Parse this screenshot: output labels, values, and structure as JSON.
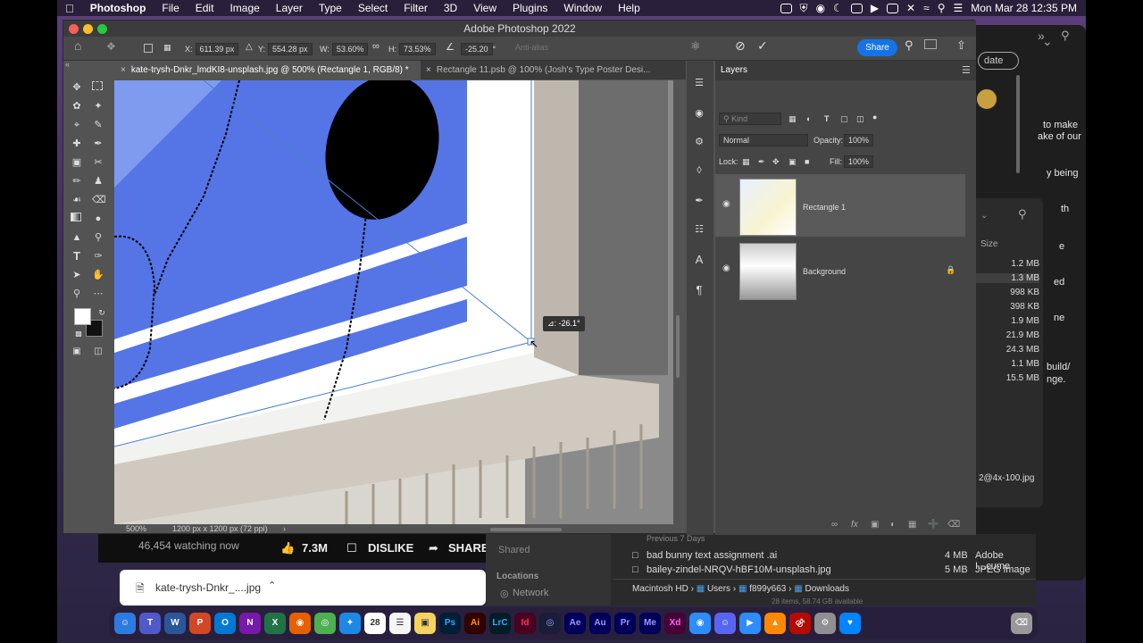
{
  "menubar": {
    "apple": "",
    "app": "Photoshop",
    "items": [
      "File",
      "Edit",
      "Image",
      "Layer",
      "Type",
      "Select",
      "Filter",
      "3D",
      "View",
      "Plugins",
      "Window",
      "Help"
    ],
    "clock": "Mon Mar 28  12:35 PM"
  },
  "window": {
    "title": "Adobe Photoshop 2022"
  },
  "options": {
    "x_label": "X:",
    "x_value": "611.39 px",
    "y_label": "Y:",
    "y_value": "554.28 px",
    "w_label": "W:",
    "w_value": "53.60%",
    "h_label": "H:",
    "h_value": "73.53%",
    "angle_value": "-25.20",
    "angle_unit": "°",
    "antialias": "Anti-alias",
    "share": "Share"
  },
  "tabs": [
    {
      "label": "kate-trysh-Dnkr_lmdKI8-unsplash.jpg @ 500% (Rectangle 1, RGB/8) *"
    },
    {
      "label": "Rectangle 11.psb @ 100% (Josh's Type Poster Desi..."
    }
  ],
  "canvas": {
    "angle_readout": "⊿: -26.1°"
  },
  "status": {
    "zoom": "500%",
    "size": "1200 px x 1200 px (72 ppi)"
  },
  "layers_panel": {
    "title": "Layers",
    "kind": "Kind",
    "blend": "Normal",
    "opacity_label": "Opacity:",
    "opacity": "100%",
    "lock_label": "Lock:",
    "fill_label": "Fill:",
    "fill": "100%",
    "layers": [
      {
        "name": "Rectangle 1"
      },
      {
        "name": "Background"
      }
    ]
  },
  "browser_bg": {
    "update": "date",
    "lines": [
      "to make",
      "ake of our",
      "y being",
      "th",
      "e",
      "ed",
      "ne",
      "build/",
      "nge."
    ]
  },
  "finder_bg": {
    "size_header": "Size",
    "sizes": [
      "1.2 MB",
      "1.3 MB",
      "998 KB",
      "398 KB",
      "1.9 MB",
      "21.9 MB",
      "24.3 MB",
      "1.1 MB",
      "15.5 MB"
    ],
    "file_tail": "2@4x-100.jpg"
  },
  "youtube": {
    "views": "46,454 watching now",
    "likes": "7.3M",
    "dislike": "DISLIKE",
    "share": "SHARE"
  },
  "download": {
    "filename": "kate-trysh-Dnkr_....jpg"
  },
  "finder_bottom": {
    "shared": "Shared",
    "locations": "Locations",
    "network": "Network",
    "prev": "Previous 7 Days",
    "files": [
      {
        "name": "bad bunny text assignment .ai",
        "size": "4 MB",
        "kind": "Adobe I...cume"
      },
      {
        "name": "bailey-zindel-NRQV-hBF10M-unsplash.jpg",
        "size": "5 MB",
        "kind": "JPEG image"
      }
    ],
    "path": [
      "Macintosh HD",
      "Users",
      "f899y663",
      "Downloads"
    ],
    "items_count": "28 items, 58.74 GB available"
  },
  "dock": {
    "apps": [
      "Finder",
      "Teams",
      "Word",
      "PowerPoint",
      "Outlook",
      "OneNote",
      "Excel",
      "Firefox",
      "Chrome",
      "Safari",
      "28",
      "Notes",
      "Stickies",
      "Ps",
      "Ai",
      "LrC",
      "Id",
      "Bridge",
      "Ae",
      "Au",
      "Pr",
      "Me",
      "Xd",
      "Zoom",
      "Discord",
      "Zoom2",
      "VLC",
      "Acrobat",
      "Settings",
      "Messenger",
      "Trash"
    ]
  }
}
